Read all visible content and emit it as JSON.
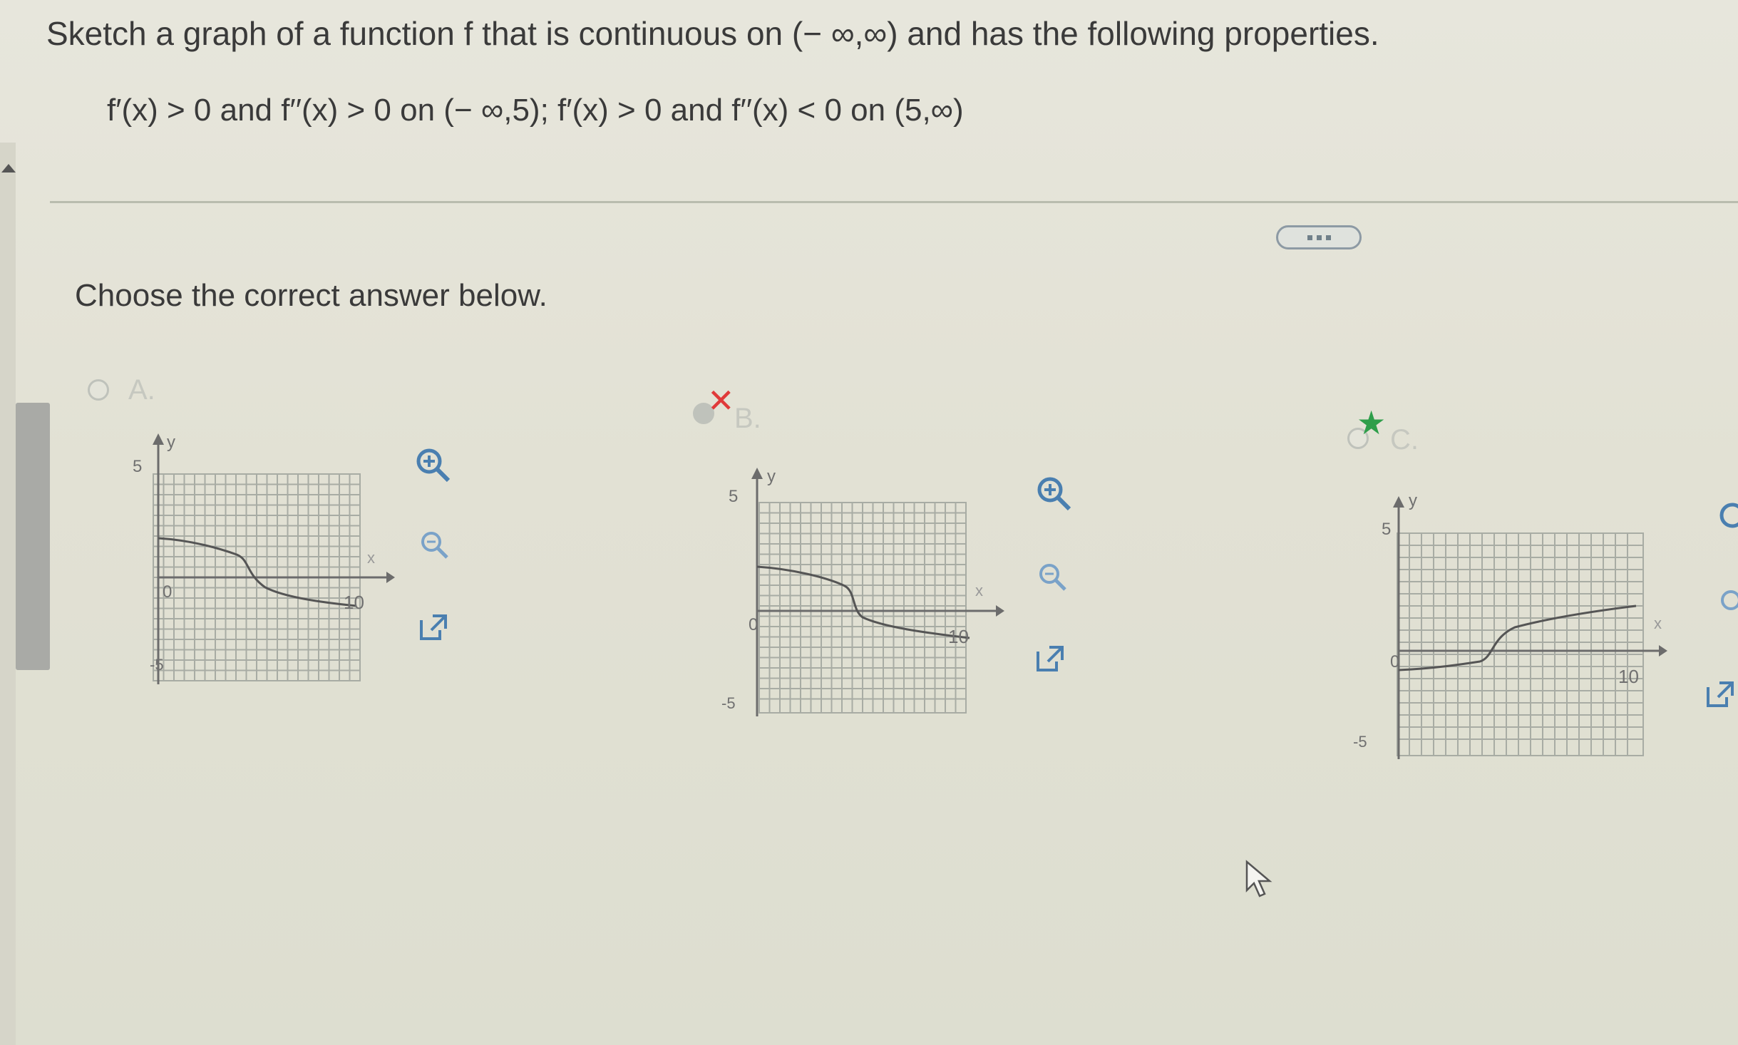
{
  "question": {
    "text": "Sketch a graph of a function f that is continuous on (− ∞,∞) and has the following properties.",
    "properties": "f′(x) > 0 and f′′(x) > 0 on (− ∞,5); f′(x) > 0 and f′′(x) < 0 on (5,∞)"
  },
  "prompt": "Choose the correct answer below.",
  "options": [
    {
      "letter": "A.",
      "state": "unselected",
      "graph": {
        "y_max_label": "5",
        "y_min_label": "-5",
        "x_label": "x",
        "y_label": "y",
        "x_tick_label": "10",
        "origin_label": "0"
      }
    },
    {
      "letter": "B.",
      "state": "incorrect",
      "graph": {
        "y_max_label": "5",
        "y_min_label": "-5",
        "x_label": "x",
        "y_label": "y",
        "x_tick_label": "10",
        "origin_label": "0"
      }
    },
    {
      "letter": "C.",
      "state": "correct",
      "graph": {
        "y_max_label": "5",
        "y_min_label": "-5",
        "x_label": "x",
        "y_label": "y",
        "x_tick_label": "10",
        "origin_label": "0"
      }
    }
  ],
  "colors": {
    "accent": "#4a7fb0",
    "incorrect": "#e03a3a",
    "correct": "#2e9e4a"
  }
}
